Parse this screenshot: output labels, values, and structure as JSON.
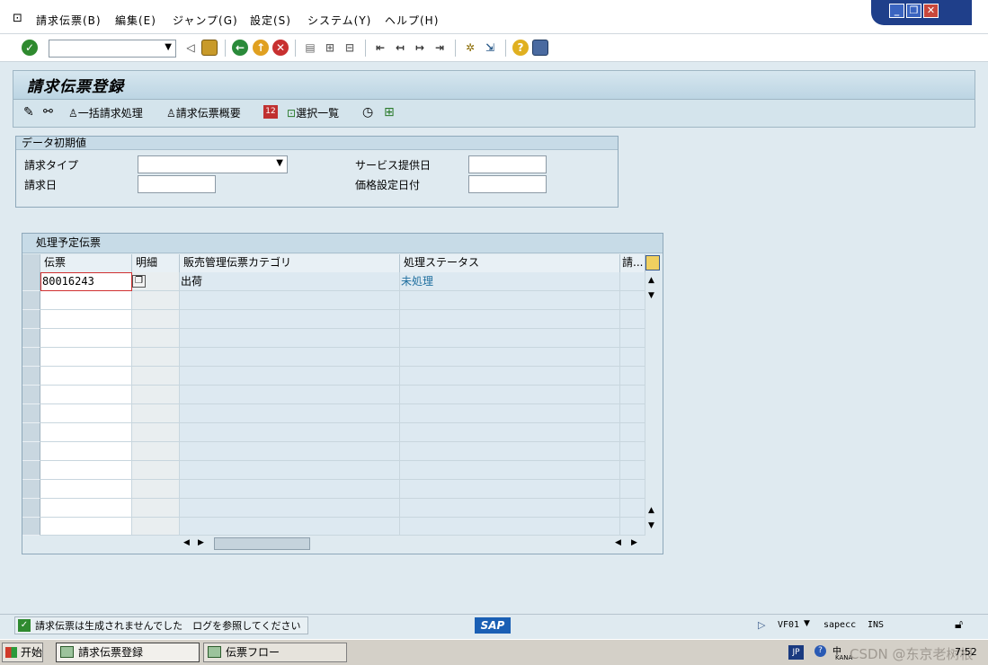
{
  "menu": {
    "items": [
      "請求伝票(B)",
      "編集(E)",
      "ジャンプ(G)",
      "設定(S)",
      "システム(Y)",
      "ヘルプ(H)"
    ]
  },
  "window_controls": {
    "minimize": "_",
    "restore": "❐",
    "close": "✕"
  },
  "toolbar": {
    "command_field_value": "",
    "icons": [
      "enter-icon",
      "back-icon",
      "save-icon",
      "exit-icon",
      "cancel-icon",
      "print-icon",
      "find-icon",
      "find-next-icon",
      "first-page-icon",
      "prev-page-icon",
      "next-page-icon",
      "last-page-icon",
      "create-session-icon",
      "shortcut-icon",
      "help-icon",
      "layout-icon"
    ]
  },
  "page": {
    "title": "請求伝票登録"
  },
  "app_toolbar": {
    "mass_billing": "一括請求処理",
    "billing_overview": "請求伝票概要",
    "selection_list": "選択一覧"
  },
  "defaults_group": {
    "title": "データ初期値",
    "billing_type_label": "請求タイプ",
    "billing_type_value": "",
    "billing_date_label": "請求日",
    "billing_date_value": "",
    "service_date_label": "サービス提供日",
    "service_date_value": "",
    "pricing_date_label": "価格設定日付",
    "pricing_date_value": ""
  },
  "docs_group": {
    "title": "処理予定伝票",
    "columns": [
      "伝票",
      "明細",
      "販売管理伝票カテゴリ",
      "処理ステータス",
      "請..."
    ],
    "rows": [
      {
        "doc": "80016243",
        "category": "出荷",
        "status": "未処理"
      }
    ]
  },
  "status_bar": {
    "message": "請求伝票は生成されませんでした　ログを参照してください",
    "transaction": "VF01",
    "system": "sapecc",
    "mode": "INS",
    "logo": "SAP"
  },
  "taskbar": {
    "start": "开始",
    "tasks": [
      "請求伝票登録",
      "伝票フロー"
    ],
    "lang": "JP",
    "ime_mode": "中",
    "kana": "KANA",
    "watermark": "CSDN @东京老树根",
    "clock": "7:52"
  },
  "colors": {
    "title_gradient": "#bcd5e3",
    "status_link": "#1f6f9f",
    "win_ctrl": "#1f3f8a"
  }
}
